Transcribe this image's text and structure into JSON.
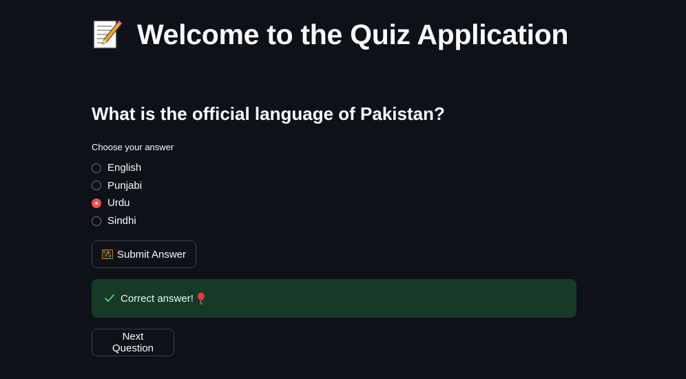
{
  "title": {
    "icon": "memo-icon",
    "text": "Welcome to the Quiz Application"
  },
  "question": {
    "text": "What is the official language of Pakistan?"
  },
  "answer_radio": {
    "label": "Choose your answer",
    "options": [
      {
        "label": "English",
        "selected": false
      },
      {
        "label": "Punjabi",
        "selected": false
      },
      {
        "label": "Urdu",
        "selected": true
      },
      {
        "label": "Sindhi",
        "selected": false
      }
    ]
  },
  "submit_button": {
    "icon": "abacus-icon",
    "label": "Submit Answer"
  },
  "feedback": {
    "icon": "checkmark-icon",
    "text": "Correct answer!",
    "trailing_icon": "balloon-icon",
    "status_color": "#173928"
  },
  "next_button": {
    "label": "Next Question"
  },
  "colors": {
    "background": "#0e1117",
    "accent": "#ff4b4b",
    "success_bg": "#173928",
    "success_text": "#dffde9"
  }
}
